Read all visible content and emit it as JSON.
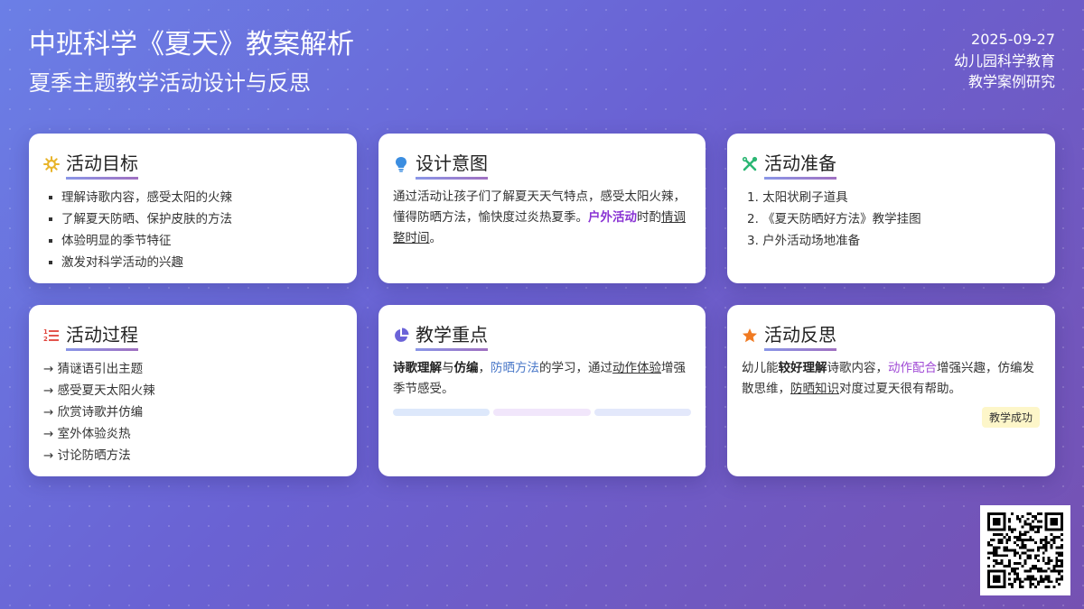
{
  "header": {
    "title": "中班科学《夏天》教案解析",
    "subtitle": "夏季主题教学活动设计与反思"
  },
  "meta": {
    "date": "2025-09-27",
    "line2": "幼儿园科学教育",
    "line3": "教学案例研究"
  },
  "cards": {
    "goals": {
      "title": "活动目标",
      "icon": "sun-icon",
      "items": [
        "理解诗歌内容，感受太阳的火辣",
        "了解夏天防晒、保护皮肤的方法",
        "体验明显的季节特征",
        "激发对科学活动的兴趣"
      ]
    },
    "design": {
      "title": "设计意图",
      "icon": "lightbulb-icon",
      "text1": "通过活动让孩子们了解夏天天气特点，感受太阳火辣，懂得防晒方法，愉快度过炎热夏季。",
      "hl": "户外活动",
      "text2": "时酌",
      "under": "情调整时间",
      "text3": "。"
    },
    "prep": {
      "title": "活动准备",
      "icon": "tools-icon",
      "items": [
        "1. 太阳状刷子道具",
        "2. 《夏天防晒好方法》教学挂图",
        "3. 户外活动场地准备"
      ]
    },
    "process": {
      "title": "活动过程",
      "icon": "numbered-list-icon",
      "items": [
        "→ 猜谜语引出主题",
        "→ 感受夏天太阳火辣",
        "→ 欣赏诗歌并仿编",
        "→ 室外体验炎热",
        "→ 讨论防晒方法"
      ]
    },
    "focus": {
      "title": "教学重点",
      "icon": "pie-chart-icon",
      "b1": "诗歌理解",
      "t1": "与",
      "b2": "仿编",
      "t2": "，",
      "blue": "防晒方法",
      "t3": "的学习，通过",
      "under": "动作体验",
      "t4": "增强季节感受。"
    },
    "reflect": {
      "title": "活动反思",
      "icon": "star-icon",
      "t1": "幼儿能",
      "b1": "较好理解",
      "t2": "诗歌内容，",
      "violet": "动作配合",
      "t3": "增强兴趣，仿编发散思维，",
      "under": "防晒知识",
      "t4": "对度过夏天很有帮助。",
      "badge": "教学成功"
    }
  },
  "colors": {
    "sun": "#e8b42a",
    "bulb": "#3b8de0",
    "tools": "#2bb673",
    "list": "#e0443b",
    "pie": "#6b63d8",
    "star": "#f07a22"
  }
}
